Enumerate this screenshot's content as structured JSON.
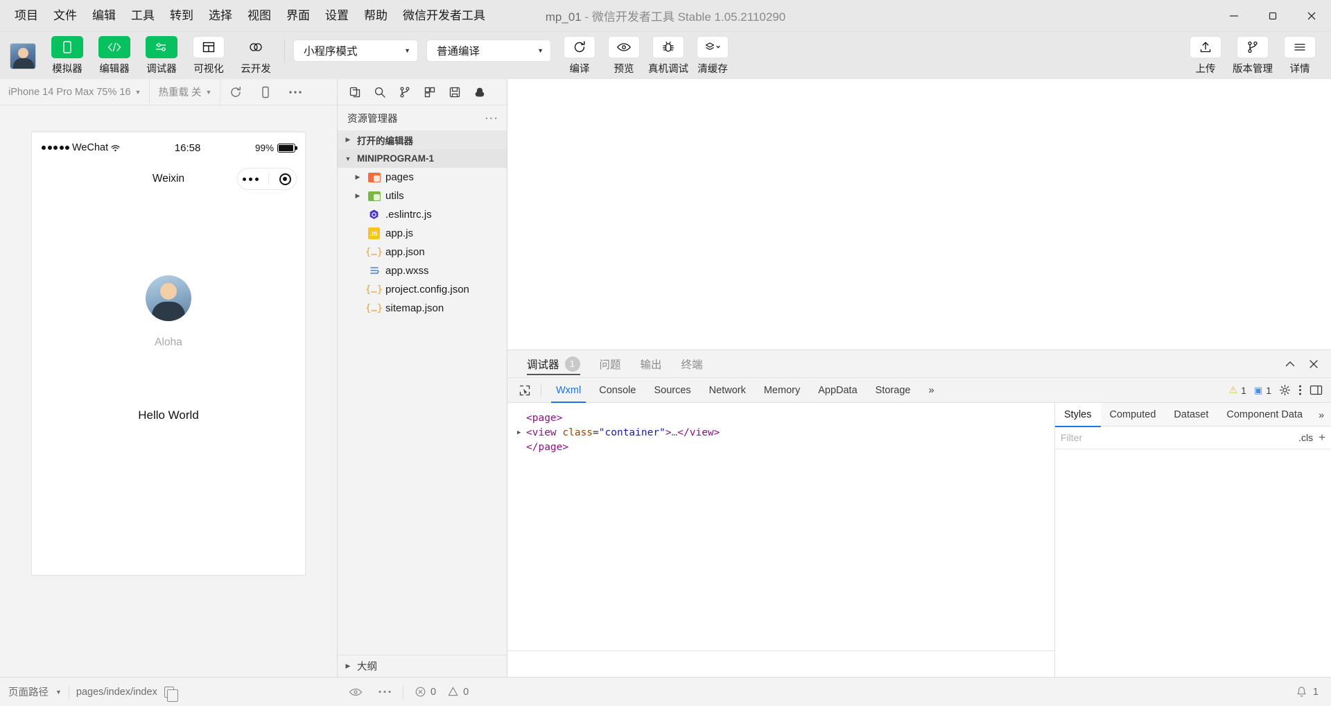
{
  "window": {
    "title_project": "mp_01",
    "title_rest": " -  微信开发者工具 Stable 1.05.2110290"
  },
  "menu": {
    "items": [
      {
        "label": "项目"
      },
      {
        "label": "文件"
      },
      {
        "label": "编辑"
      },
      {
        "label": "工具"
      },
      {
        "label": "转到"
      },
      {
        "label": "选择"
      },
      {
        "label": "视图"
      },
      {
        "label": "界面"
      },
      {
        "label": "设置"
      },
      {
        "label": "帮助"
      },
      {
        "label": "微信开发者工具"
      }
    ]
  },
  "toolbar": {
    "left_buttons": [
      {
        "label": "模拟器",
        "icon": "phone-icon",
        "style": "green"
      },
      {
        "label": "编辑器",
        "icon": "code-icon",
        "style": "green"
      },
      {
        "label": "调试器",
        "icon": "sliders-icon",
        "style": "green"
      },
      {
        "label": "可视化",
        "icon": "layout-icon",
        "style": "white"
      },
      {
        "label": "云开发",
        "icon": "cloud-icon",
        "style": "plain"
      }
    ],
    "mode_select": {
      "value": "小程序模式",
      "caret": "▼"
    },
    "build_select": {
      "value": "普通编译",
      "caret": "▼"
    },
    "action_buttons": [
      {
        "label": "编译",
        "icon": "refresh-icon"
      },
      {
        "label": "预览",
        "icon": "eye-icon"
      },
      {
        "label": "真机调试",
        "icon": "bug-icon"
      },
      {
        "label": "清缓存",
        "icon": "layers-icon",
        "caret": "▼"
      }
    ],
    "right_buttons": [
      {
        "label": "上传",
        "icon": "upload-icon"
      },
      {
        "label": "版本管理",
        "icon": "branch-icon"
      },
      {
        "label": "详情",
        "icon": "menu-icon"
      }
    ]
  },
  "simulator": {
    "device": "iPhone 14 Pro Max 75% 16",
    "device_caret": "▼",
    "hot_reload": "热重载 关",
    "hot_reload_caret": "▼",
    "icons": [
      "refresh-icon",
      "rotate-icon",
      "more-icon"
    ],
    "phone": {
      "carrier": "WeChat",
      "time": "16:58",
      "battery_pct": "99%",
      "nav_title": "Weixin",
      "user_name": "Aloha",
      "content_text": "Hello World"
    }
  },
  "editor": {
    "toolbar_icons": [
      "files-icon",
      "search-icon",
      "source-control-icon",
      "extensions-icon",
      "save-icon",
      "debug-icon"
    ],
    "explorer_title": "资源管理器",
    "explorer_more": "···",
    "sections": [
      {
        "label": "打开的编辑器",
        "arrow": "▶"
      },
      {
        "label": "MINIPROGRAM-1",
        "arrow": "▼"
      }
    ],
    "files": [
      {
        "name": "pages",
        "icon": "folder-orange-icon",
        "arrow": "▶",
        "type": "folder"
      },
      {
        "name": "utils",
        "icon": "folder-green-icon",
        "arrow": "▶",
        "type": "folder"
      },
      {
        "name": ".eslintrc.js",
        "icon": "eslint-icon",
        "arrow": "",
        "type": "file"
      },
      {
        "name": "app.js",
        "icon": "js-icon",
        "arrow": "",
        "type": "file"
      },
      {
        "name": "app.json",
        "icon": "json-icon",
        "arrow": "",
        "type": "file"
      },
      {
        "name": "app.wxss",
        "icon": "wxss-icon",
        "arrow": "",
        "type": "file"
      },
      {
        "name": "project.config.json",
        "icon": "json-icon",
        "arrow": "",
        "type": "file"
      },
      {
        "name": "sitemap.json",
        "icon": "json-icon",
        "arrow": "",
        "type": "file"
      }
    ],
    "outline": {
      "label": "大纲",
      "arrow": "▶"
    }
  },
  "devtools": {
    "tabs": [
      {
        "label": "调试器",
        "badge": "1",
        "active": true
      },
      {
        "label": "问题",
        "badge": "",
        "active": false
      },
      {
        "label": "输出",
        "badge": "",
        "active": false
      },
      {
        "label": "终端",
        "badge": "",
        "active": false
      }
    ],
    "panel_actions": [
      "chevron-up-icon",
      "close-icon"
    ],
    "subtabs": [
      {
        "label": "Wxml",
        "active": true
      },
      {
        "label": "Console",
        "active": false
      },
      {
        "label": "Sources",
        "active": false
      },
      {
        "label": "Network",
        "active": false
      },
      {
        "label": "Memory",
        "active": false
      },
      {
        "label": "AppData",
        "active": false
      },
      {
        "label": "Storage",
        "active": false
      }
    ],
    "overflow": "»",
    "warning_count": "1",
    "message_count": "1",
    "code": {
      "line1": "<page>",
      "line2_tag_open": "<view ",
      "line2_attr": "class",
      "line2_eq": "=",
      "line2_val": "\"container\"",
      "line2_gt": ">",
      "line2_ellipsis": "…",
      "line2_close": "</view>",
      "line3": "</page>"
    },
    "styles": {
      "tabs": [
        {
          "label": "Styles",
          "active": true
        },
        {
          "label": "Computed",
          "active": false
        },
        {
          "label": "Dataset",
          "active": false
        },
        {
          "label": "Component Data",
          "active": false
        }
      ],
      "more": "»",
      "filter_placeholder": "Filter",
      "cls_label": ".cls",
      "plus_label": "+"
    }
  },
  "statusbar": {
    "page_path_label": "页面路径",
    "page_path_caret": "▼",
    "page_path_value": "pages/index/index",
    "copy_icon": "copy-icon",
    "eye_icon": "eye-icon",
    "more_icon": "more-icon",
    "error_count": "0",
    "warning_count": "0",
    "bell_count": "1"
  },
  "colors": {
    "brand_green": "#07c160",
    "accent_blue": "#1a73e8",
    "titlebar_bg": "#e8e8e8",
    "panel_bg": "#f3f3f3"
  }
}
